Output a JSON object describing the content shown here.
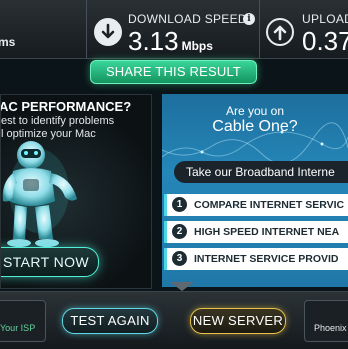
{
  "stats": {
    "ping_unit": "ms",
    "download": {
      "label": "DOWNLOAD SPEED",
      "value": "3.13",
      "unit": "Mbps"
    },
    "upload": {
      "label": "UPLOAD",
      "value": "0.37"
    },
    "info_icon": "info-icon",
    "icons": [
      "download-arrow-icon",
      "upload-arrow-icon"
    ]
  },
  "share": {
    "label": "SHARE THIS RESULT"
  },
  "mac_ad": {
    "title": "AC PERFORMANCE?",
    "line1": "est to identify problems",
    "line2": "l optimize your Mac",
    "cta": "START NOW"
  },
  "isp_ad": {
    "question_small": "Are you on",
    "question_big": "Cable One?",
    "banner": "Take our Broadband Interne",
    "items": [
      {
        "num": "1",
        "text": "COMPARE INTERNET SERVIC"
      },
      {
        "num": "2",
        "text": "HIGH SPEED INTERNET NEA"
      },
      {
        "num": "3",
        "text": "INTERNET SERVICE PROVID"
      }
    ]
  },
  "bottom": {
    "isp_label": "Your ISP",
    "test_again": "TEST AGAIN",
    "new_server": "NEW SERVER",
    "server_city": "Phoenix"
  },
  "colors": {
    "share_green": "#22b87a",
    "test_again_cyan": "#5fd8e6",
    "new_server_gold": "#e8c24a",
    "isp_ad_blue": "#2586b8"
  }
}
